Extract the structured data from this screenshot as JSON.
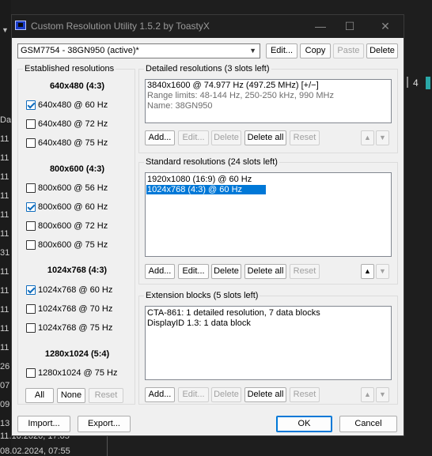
{
  "background": {
    "left_numbers": [
      "11",
      "11",
      "11",
      "11",
      "11",
      "11",
      "31",
      "11",
      "11",
      "11",
      "11",
      "11",
      "11",
      "26",
      "11",
      "07",
      "11",
      "09",
      "11",
      "13",
      "10",
      "11"
    ],
    "left_header": "Da",
    "right_digit": "4",
    "bottom_lines": [
      "11.10.2020, 17:05",
      "08.02.2024, 07:55"
    ]
  },
  "window": {
    "title": "Custom Resolution Utility 1.5.2 by ToastyX",
    "controls": {
      "minimize": "—",
      "maximize": "☐",
      "close": "✕"
    }
  },
  "monitor": {
    "selected": "GSM7754 - 38GN950 (active)*",
    "buttons": {
      "edit": "Edit...",
      "copy": "Copy",
      "paste": "Paste",
      "delete": "Delete"
    }
  },
  "established": {
    "label": "Established resolutions",
    "groups": [
      {
        "heading": "640x480 (4:3)",
        "items": [
          {
            "label": "640x480 @ 60 Hz",
            "checked": true
          },
          {
            "label": "640x480 @ 72 Hz",
            "checked": false
          },
          {
            "label": "640x480 @ 75 Hz",
            "checked": false
          }
        ]
      },
      {
        "heading": "800x600 (4:3)",
        "items": [
          {
            "label": "800x600 @ 56 Hz",
            "checked": false
          },
          {
            "label": "800x600 @ 60 Hz",
            "checked": true
          },
          {
            "label": "800x600 @ 72 Hz",
            "checked": false
          },
          {
            "label": "800x600 @ 75 Hz",
            "checked": false
          }
        ]
      },
      {
        "heading": "1024x768 (4:3)",
        "items": [
          {
            "label": "1024x768 @ 60 Hz",
            "checked": true
          },
          {
            "label": "1024x768 @ 70 Hz",
            "checked": false
          },
          {
            "label": "1024x768 @ 75 Hz",
            "checked": false
          }
        ]
      },
      {
        "heading": "1280x1024 (5:4)",
        "items": [
          {
            "label": "1280x1024 @ 75 Hz",
            "checked": false
          }
        ]
      }
    ],
    "buttons": {
      "all": "All",
      "none": "None",
      "reset": "Reset"
    }
  },
  "detailed": {
    "label": "Detailed resolutions (3 slots left)",
    "lines": [
      "3840x1600 @ 74.977 Hz (497.25 MHz) [+/−]",
      "Range limits: 48-144 Hz, 250-250 kHz, 990 MHz",
      "Name: 38GN950"
    ]
  },
  "standard": {
    "label": "Standard resolutions (24 slots left)",
    "lines": [
      "1920x1080 (16:9) @ 60 Hz",
      "1024x768 (4:3) @ 60 Hz"
    ]
  },
  "extension": {
    "label": "Extension blocks (5 slots left)",
    "lines": [
      "CTA-861: 1 detailed resolution, 7 data blocks",
      "DisplayID 1.3: 1 data block"
    ]
  },
  "section_buttons": {
    "add": "Add...",
    "edit": "Edit...",
    "delete": "Delete",
    "delete_all": "Delete all",
    "reset": "Reset",
    "up": "▲",
    "down": "▼"
  },
  "footer": {
    "import": "Import...",
    "export": "Export...",
    "ok": "OK",
    "cancel": "Cancel"
  }
}
